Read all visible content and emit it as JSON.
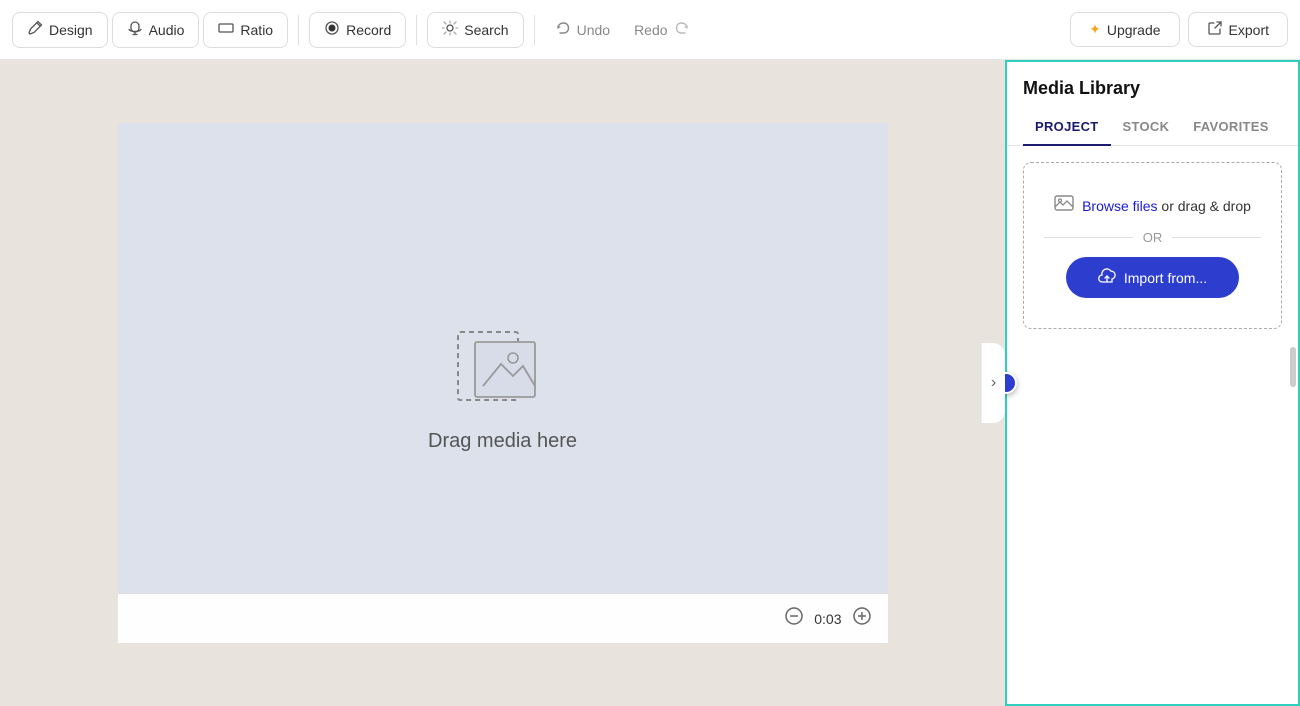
{
  "toolbar": {
    "design_label": "Design",
    "audio_label": "Audio",
    "ratio_label": "Ratio",
    "record_label": "Record",
    "search_label": "Search",
    "undo_label": "Undo",
    "redo_label": "Redo",
    "upgrade_label": "Upgrade",
    "export_label": "Export"
  },
  "canvas": {
    "drag_text": "Drag media here",
    "time": "0:03"
  },
  "media_library": {
    "title": "Media Library",
    "tabs": [
      {
        "id": "project",
        "label": "PROJECT",
        "active": true
      },
      {
        "id": "stock",
        "label": "STOCK",
        "active": false
      },
      {
        "id": "favorites",
        "label": "FAVORITES",
        "active": false
      }
    ],
    "upload": {
      "browse_text": "Browse files",
      "drag_text": " or drag & drop",
      "or_label": "OR",
      "import_label": "Import from..."
    }
  },
  "icons": {
    "design": "✏️",
    "audio": "♪",
    "ratio": "▭",
    "record": "⏺",
    "search": "✦",
    "undo": "↩",
    "redo": "↪",
    "upgrade": "✦",
    "export": "↗",
    "image": "🖼",
    "cloud": "☁",
    "minus": "⊖",
    "plus": "⊕",
    "chevron_right": "›"
  }
}
